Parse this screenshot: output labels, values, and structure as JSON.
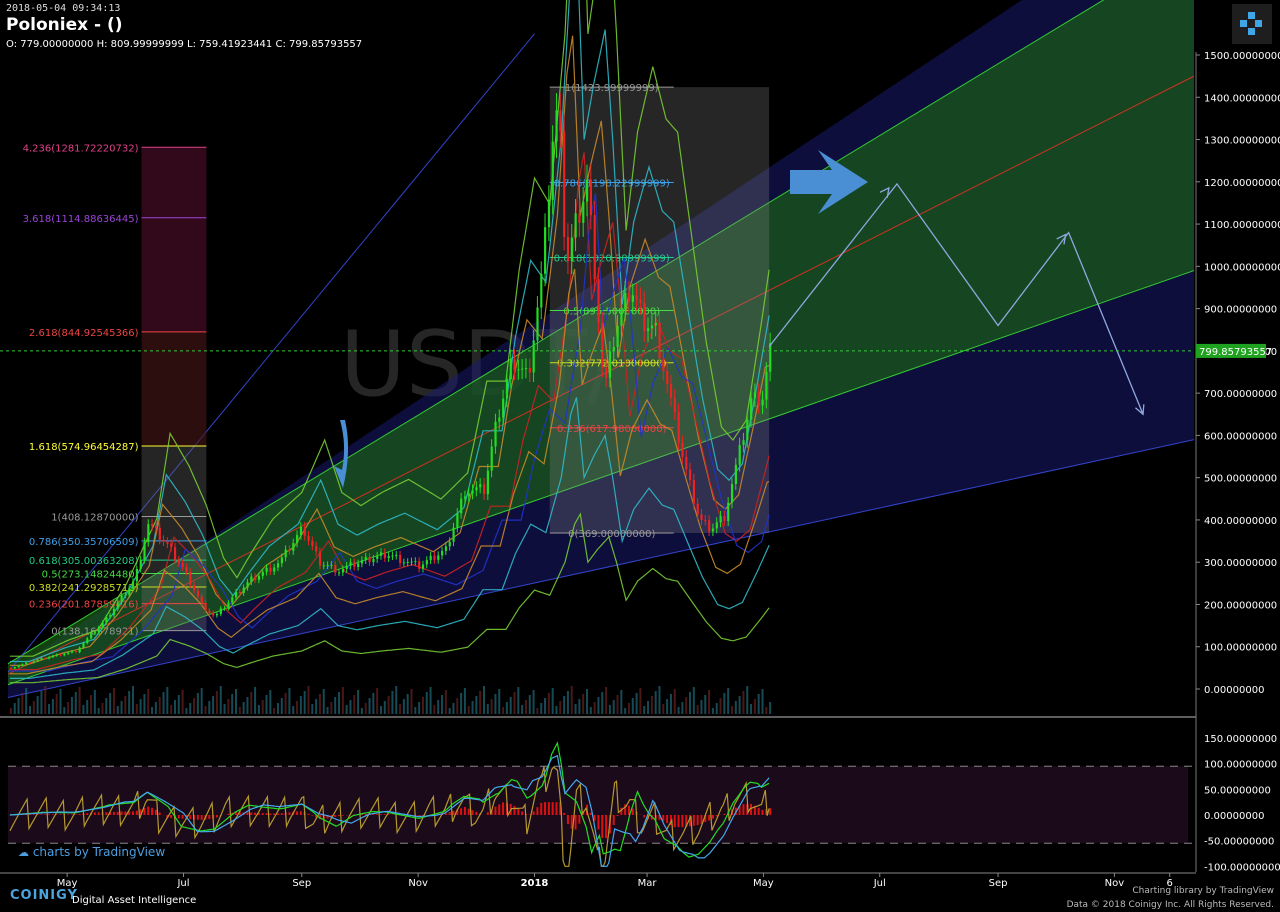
{
  "header": {
    "timestamp": "2018-05-04 09:34:13",
    "title": "Poloniex -  ()",
    "ohlc": "O: 779.00000000 H: 809.99999999 L: 759.41923441 C: 799.85793557"
  },
  "watermark": "USDT/",
  "branding": {
    "tradingview_credit": "charts by TradingView",
    "logo": "COINIGY",
    "tagline": "Digital Asset Intelligence",
    "library_credit": "Charting library by  TradingView",
    "data_credit": "Data © 2018  Coinigy Inc. All Rights Reserved."
  },
  "colors": {
    "bull": "#22dd22",
    "bear": "#ee2222",
    "green_channel": "#1a5c16",
    "blue_channel": "#1a1a6e",
    "current_price_bg": "#1fa21f",
    "arrow_blue": "#4a8fd4"
  },
  "chart_data": [
    {
      "type": "candlestick",
      "series_name": "USDT/ETH",
      "x_ticks": [
        "May",
        "Jul",
        "Sep",
        "Nov",
        "2018",
        "Mar",
        "May",
        "Jul",
        "Sep",
        "Nov",
        "6"
      ],
      "y_ticks": [
        "1500.00000000",
        "1400.00000000",
        "1300.00000000",
        "1200.00000000",
        "1100.00000000",
        "1000.00000000",
        "900.00000000",
        "800.00000000",
        "700.00000000",
        "600.00000000",
        "500.00000000",
        "400.00000000",
        "300.00000000",
        "200.00000000",
        "100.00000000",
        "0.00000000"
      ],
      "ylim": [
        -30,
        1500
      ],
      "current_price": 799.85793557,
      "current_price_label": "799.85793557",
      "price_path": [
        [
          "2017-04-01",
          50
        ],
        [
          "2017-04-20",
          75
        ],
        [
          "2017-05-05",
          90
        ],
        [
          "2017-05-20",
          160
        ],
        [
          "2017-06-05",
          260
        ],
        [
          "2017-06-12",
          390
        ],
        [
          "2017-06-22",
          340
        ],
        [
          "2017-07-01",
          280
        ],
        [
          "2017-07-10",
          200
        ],
        [
          "2017-07-17",
          170
        ],
        [
          "2017-07-25",
          210
        ],
        [
          "2017-08-05",
          260
        ],
        [
          "2017-08-20",
          300
        ],
        [
          "2017-09-01",
          380
        ],
        [
          "2017-09-10",
          300
        ],
        [
          "2017-09-20",
          280
        ],
        [
          "2017-10-01",
          300
        ],
        [
          "2017-10-15",
          320
        ],
        [
          "2017-11-01",
          290
        ],
        [
          "2017-11-15",
          330
        ],
        [
          "2017-11-25",
          470
        ],
        [
          "2017-12-05",
          470
        ],
        [
          "2017-12-12",
          640
        ],
        [
          "2017-12-20",
          780
        ],
        [
          "2017-12-28",
          740
        ],
        [
          "2018-01-05",
          1000
        ],
        [
          "2018-01-10",
          1300
        ],
        [
          "2018-01-13",
          1380
        ],
        [
          "2018-01-17",
          1000
        ],
        [
          "2018-01-22",
          1100
        ],
        [
          "2018-01-28",
          1200
        ],
        [
          "2018-02-01",
          1000
        ],
        [
          "2018-02-06",
          700
        ],
        [
          "2018-02-12",
          850
        ],
        [
          "2018-02-20",
          950
        ],
        [
          "2018-02-27",
          870
        ],
        [
          "2018-03-05",
          850
        ],
        [
          "2018-03-12",
          700
        ],
        [
          "2018-03-20",
          530
        ],
        [
          "2018-03-28",
          400
        ],
        [
          "2018-04-03",
          380
        ],
        [
          "2018-04-10",
          410
        ],
        [
          "2018-04-18",
          560
        ],
        [
          "2018-04-24",
          680
        ],
        [
          "2018-04-30",
          690
        ],
        [
          "2018-05-04",
          800
        ]
      ],
      "fib_left": {
        "color_note": "fib retracement on 2017 move",
        "levels": [
          {
            "label": "4.236(1281.72220732)",
            "value": 1281.72220732,
            "color": "#e0408a"
          },
          {
            "label": "3.618(1114.88636445)",
            "value": 1114.88636445,
            "color": "#9b44d8"
          },
          {
            "label": "2.618(844.92545366)",
            "value": 844.92545366,
            "color": "#ee4444"
          },
          {
            "label": "1.618(574.96454287)",
            "value": 574.96454287,
            "color": "#ffff33"
          },
          {
            "label": "1(408.12870000)",
            "value": 408.1287,
            "color": "#999999"
          },
          {
            "label": "0.786(350.35706509)",
            "value": 350.35706509,
            "color": "#3fa0e8"
          },
          {
            "label": "0.618(305.00363208)",
            "value": 305.00363208,
            "color": "#22cc88"
          },
          {
            "label": "0.5(273.14824480)",
            "value": 273.1482448,
            "color": "#44dd44"
          },
          {
            "label": "0.382(241.29285713)",
            "value": 241.29285713,
            "color": "#ccdd22"
          },
          {
            "label": "0.236(201.87859416)",
            "value": 201.87859416,
            "color": "#ee4444"
          },
          {
            "label": "0(138.16378921)",
            "value": 138.16378921,
            "color": "#999999"
          }
        ]
      },
      "fib_right": {
        "levels": [
          {
            "label": "1(1423.99999999)",
            "value": 1423.99999999,
            "color": "#999999"
          },
          {
            "label": "0.786(1198.22999999)",
            "value": 1198.22999999,
            "color": "#3fa0e8"
          },
          {
            "label": "0.618(1020.98999999)",
            "value": 1020.98999999,
            "color": "#22cc88"
          },
          {
            "label": "0.5(895.50000000)",
            "value": 895.5,
            "color": "#44dd44"
          },
          {
            "label": "0.382(772.01000000)",
            "value": 772.01,
            "color": "#ccdd22"
          },
          {
            "label": "0.236(617.98000000)",
            "value": 617.98,
            "color": "#ee4444"
          },
          {
            "label": "0(369.00000000)",
            "value": 369.0,
            "color": "#999999"
          }
        ]
      }
    },
    {
      "type": "oscillator",
      "y_ticks": [
        "150.00000000",
        "100.00000000",
        "50.00000000",
        "0.00000000",
        "-50.00000000",
        "-100.00000000"
      ],
      "ylim": [
        -110,
        170
      ],
      "upper_band": 95,
      "lower_band": -55
    }
  ]
}
